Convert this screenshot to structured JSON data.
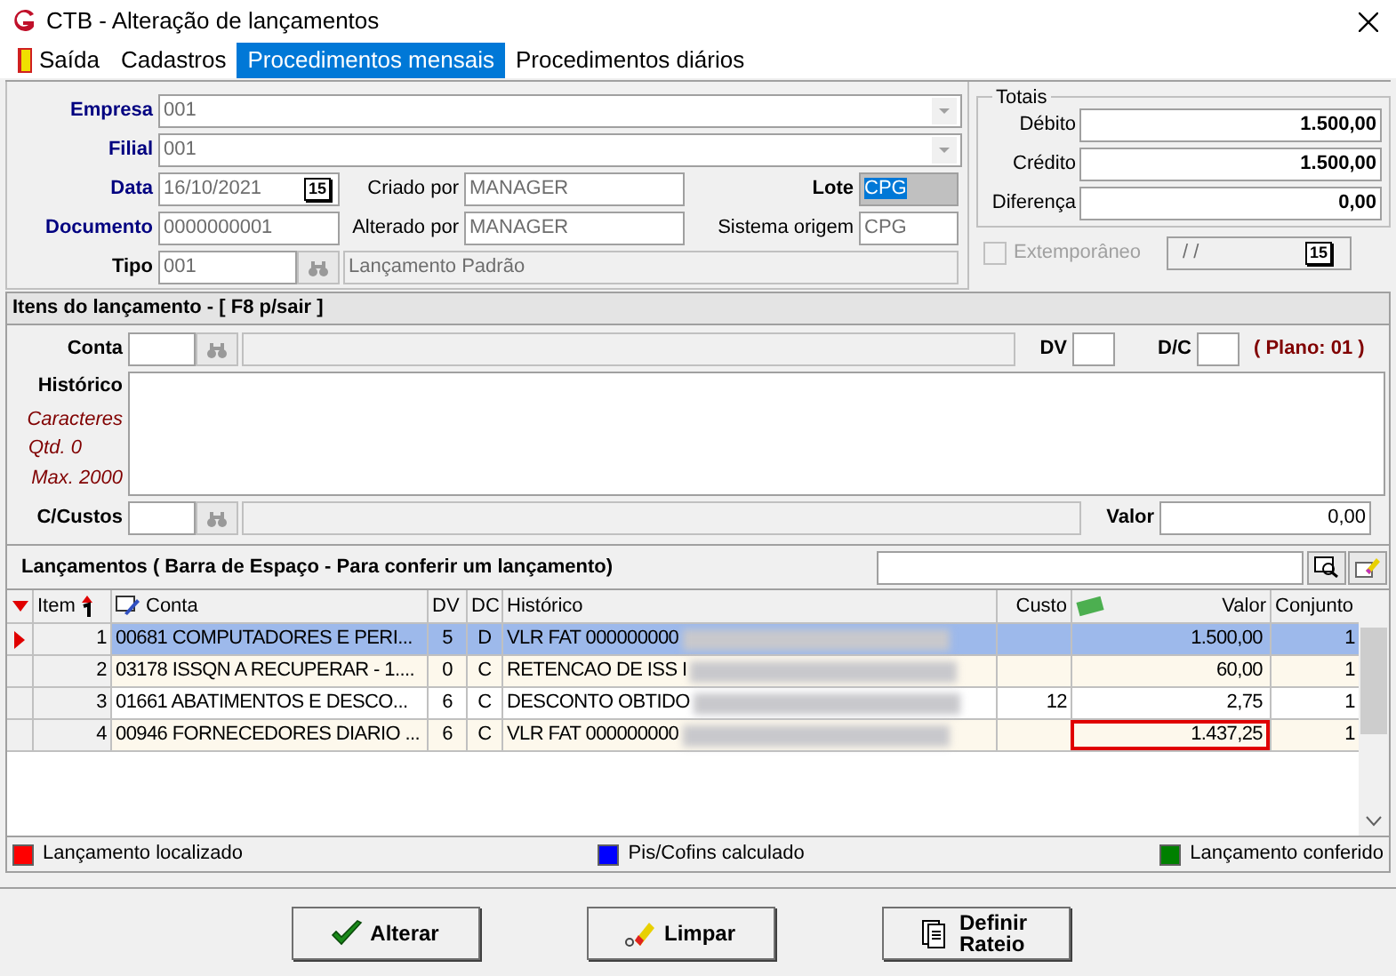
{
  "window": {
    "title": "CTB - Alteração de lançamentos"
  },
  "menu": [
    {
      "label": "Saída",
      "selected": false
    },
    {
      "label": "Cadastros",
      "selected": false
    },
    {
      "label": "Procedimentos mensais",
      "selected": true
    },
    {
      "label": "Procedimentos diários",
      "selected": false
    }
  ],
  "header": {
    "empresa": {
      "label": "Empresa",
      "value": "001"
    },
    "filial": {
      "label": "Filial",
      "value": "001"
    },
    "data": {
      "label": "Data",
      "value": "16/10/2021",
      "calendar": "15"
    },
    "criado_por": {
      "label": "Criado por",
      "value": "MANAGER"
    },
    "lote": {
      "label": "Lote",
      "value": "CPG"
    },
    "documento": {
      "label": "Documento",
      "value": "0000000001"
    },
    "alterado_por": {
      "label": "Alterado por",
      "value": "MANAGER"
    },
    "sistema_origem": {
      "label": "Sistema origem",
      "value": "CPG"
    },
    "tipo": {
      "label": "Tipo",
      "value": "001",
      "description": "Lançamento Padrão"
    }
  },
  "totais": {
    "title": "Totais",
    "rows": [
      {
        "label": "Débito",
        "value": "1.500,00"
      },
      {
        "label": "Crédito",
        "value": "1.500,00"
      },
      {
        "label": "Diferença",
        "value": "0,00"
      }
    ]
  },
  "extemporaneo": {
    "label": "Extemporâneo",
    "checked": false,
    "disabled": true,
    "value": "/ /",
    "calendar": "15"
  },
  "itens": {
    "title": "Itens do lançamento - [ F8 p/sair ]",
    "conta_label": "Conta",
    "dv_label": "DV",
    "dc_label": "D/C",
    "plano": "( Plano: 01 )",
    "historico_label": "Histórico",
    "caracteres": "Caracteres",
    "qtd": "Qtd. 0",
    "max": "Max. 2000",
    "custos_label": "C/Custos",
    "valor_label": "Valor",
    "valor": "0,00"
  },
  "lancamentos": {
    "title": "Lançamentos ( Barra de Espaço - Para conferir um lançamento)"
  },
  "table": {
    "columns": [
      "Item",
      "Conta",
      "DV",
      "DC",
      "Histórico",
      "Custo",
      "Valor",
      "Conjunto"
    ],
    "rows": [
      {
        "item": "1",
        "conta": "00681 COMPUTADORES E PERI...",
        "dv": "5",
        "dc": "D",
        "historico": "VLR FAT 000000000",
        "custo": "",
        "valor": "1.500,00",
        "conjunto": "1",
        "selected": true,
        "valor_marked": false
      },
      {
        "item": "2",
        "conta": "03178 ISSQN A RECUPERAR - 1....",
        "dv": "0",
        "dc": "C",
        "historico": "RETENCAO DE ISS I",
        "custo": "",
        "valor": "60,00",
        "conjunto": "1",
        "selected": false,
        "valor_marked": false
      },
      {
        "item": "3",
        "conta": "01661 ABATIMENTOS E DESCO...",
        "dv": "6",
        "dc": "C",
        "historico": "DESCONTO OBTIDO",
        "custo": "12",
        "valor": "2,75",
        "conjunto": "1",
        "selected": false,
        "valor_marked": false
      },
      {
        "item": "4",
        "conta": "00946 FORNECEDORES DIARIO ...",
        "dv": "6",
        "dc": "C",
        "historico": "VLR FAT 000000000",
        "custo": "",
        "valor": "1.437,25",
        "conjunto": "1",
        "selected": false,
        "valor_marked": true
      }
    ]
  },
  "legend": [
    {
      "label": "Lançamento localizado",
      "color": "#ff0000"
    },
    {
      "label": "Pis/Cofins calculado",
      "color": "#0000ff"
    },
    {
      "label": "Lançamento conferido",
      "color": "#008000"
    }
  ],
  "buttons": [
    {
      "kind": "check",
      "label": "Alterar"
    },
    {
      "kind": "eraser",
      "label": "Limpar"
    },
    {
      "kind": "pages",
      "label": "Definir Rateio"
    }
  ]
}
